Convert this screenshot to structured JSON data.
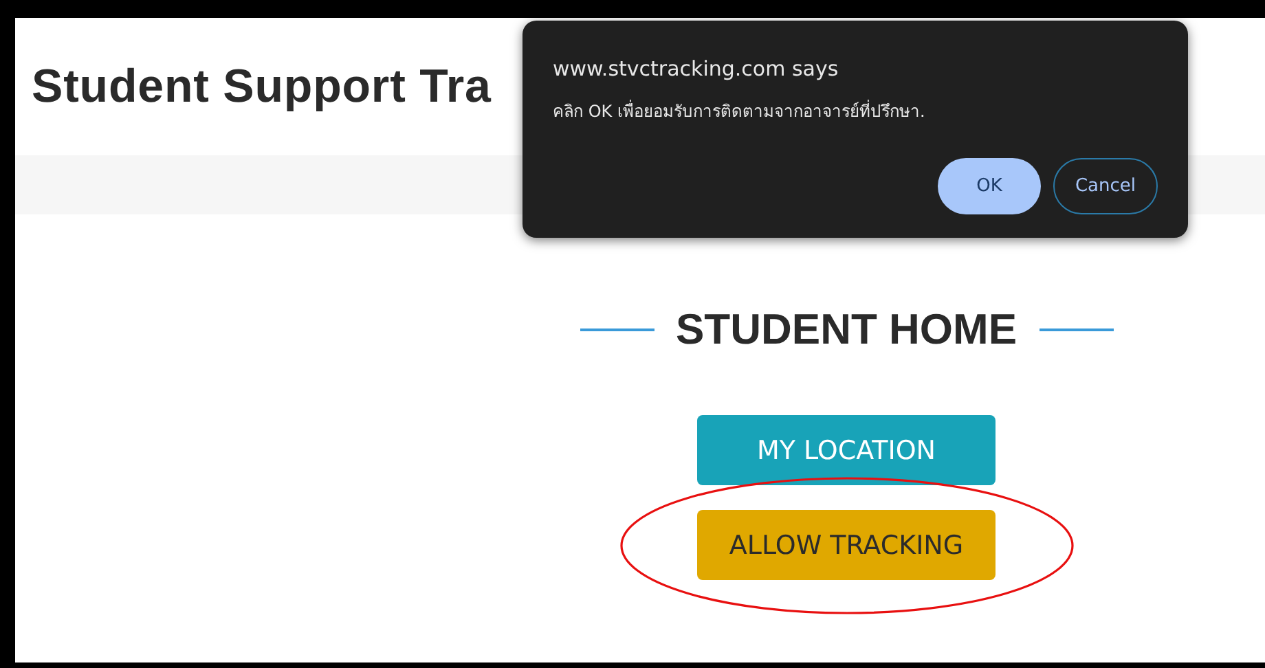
{
  "page": {
    "title": "Student Support Tra"
  },
  "section": {
    "heading": "STUDENT HOME"
  },
  "buttons": [
    {
      "label": "MY LOCATION",
      "kind": "info",
      "highlighted": false
    },
    {
      "label": "ALLOW TRACKING",
      "kind": "warning",
      "highlighted": true
    }
  ],
  "dialog": {
    "origin": "www.stvctracking.com says",
    "message": "คลิก OK เพื่อยอมรับการติดตามจากอาจารย์ที่ปรึกษา.",
    "buttons": [
      {
        "label": "OK",
        "kind": "primary"
      },
      {
        "label": "Cancel",
        "kind": "secondary"
      }
    ]
  }
}
